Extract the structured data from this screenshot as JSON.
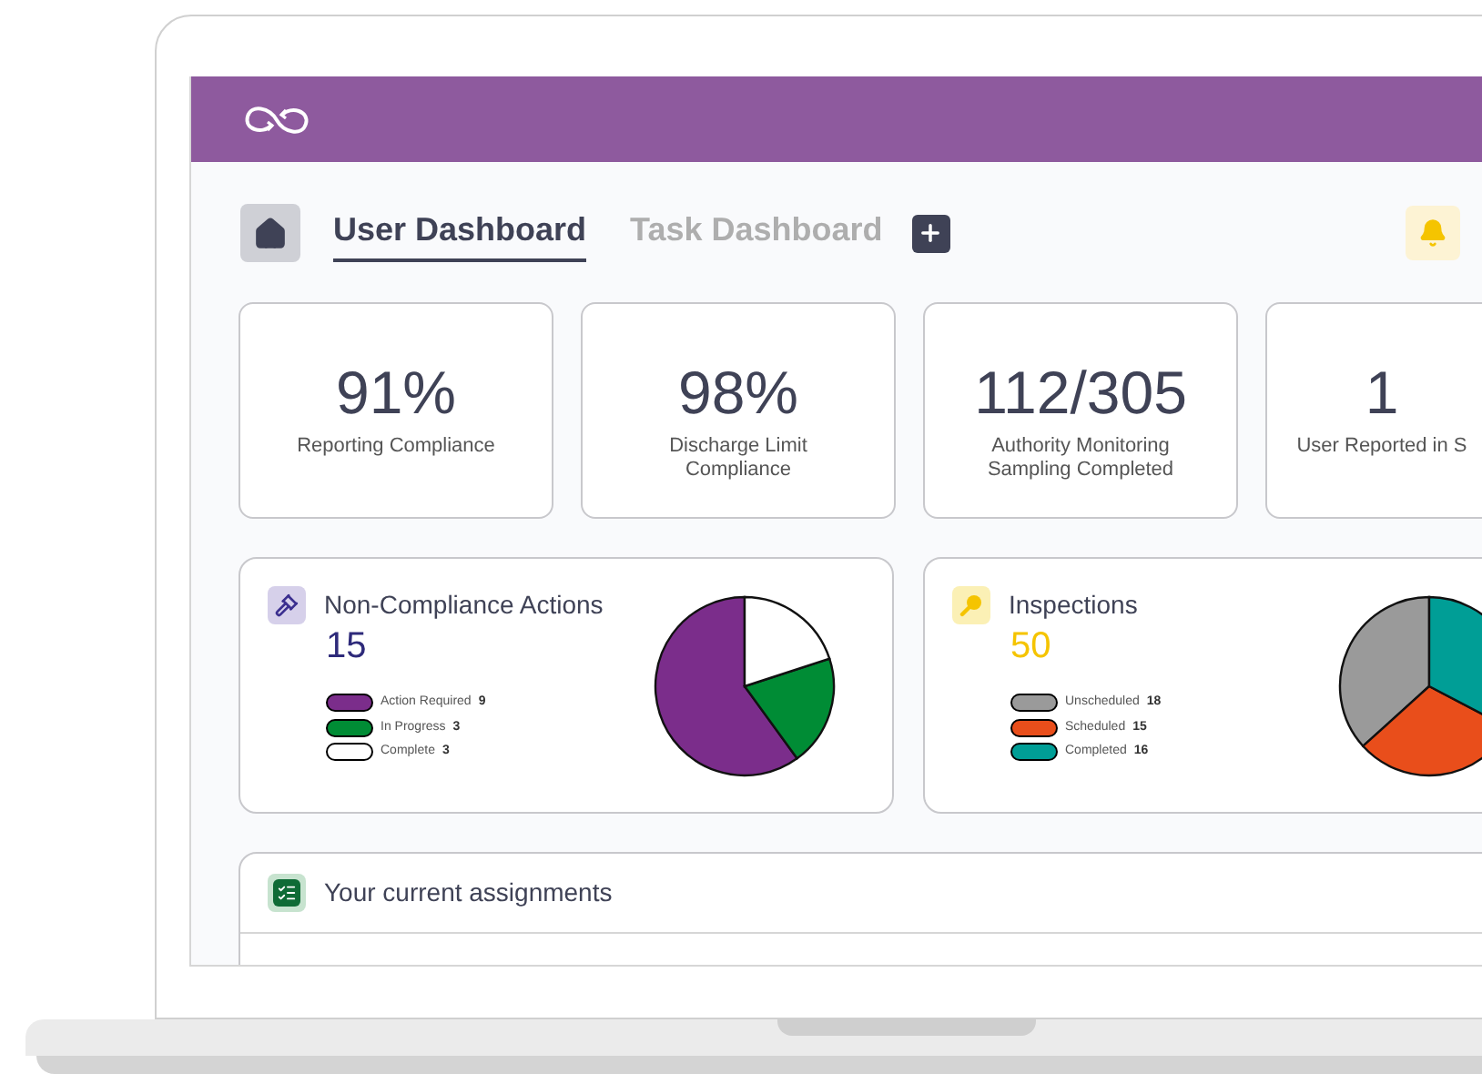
{
  "tabs": [
    {
      "label": "User Dashboard",
      "selected": true
    },
    {
      "label": "Task Dashboard",
      "selected": false
    }
  ],
  "stats": [
    {
      "value": "91%",
      "label": "Reporting Compliance"
    },
    {
      "value": "98%",
      "label": "Discharge Limit Compliance"
    },
    {
      "value": "112/305",
      "label": "Authority Monitoring Sampling Completed"
    },
    {
      "value": "1",
      "label": "User Reported in S"
    }
  ],
  "chart_cards": [
    {
      "kind": "actions",
      "title": "Non-Compliance Actions",
      "total": "15",
      "legend": [
        {
          "count": "9",
          "color": "#7b2d8b"
        },
        {
          "count": "3",
          "color": "#008c35"
        },
        {
          "count": "3",
          "color": "#ffffff"
        }
      ],
      "chart_data": {
        "type": "pie",
        "categories": [
          "Action Required",
          "In Progress",
          "Complete"
        ],
        "values": [
          60,
          20,
          20
        ]
      }
    },
    {
      "kind": "inspections",
      "title": "Inspections",
      "total": "50",
      "legend": [
        {
          "count": "18",
          "color": "#9a9a9a"
        },
        {
          "count": "15",
          "color": "#e94e1b"
        },
        {
          "count": "16",
          "color": "#009e96"
        }
      ],
      "chart_data": {
        "type": "pie",
        "categories": [
          "Unscheduled",
          "Scheduled",
          "Completed"
        ],
        "values": [
          36.7,
          30.6,
          32.7
        ]
      }
    }
  ],
  "assignments": {
    "title": "Your current assignments"
  }
}
